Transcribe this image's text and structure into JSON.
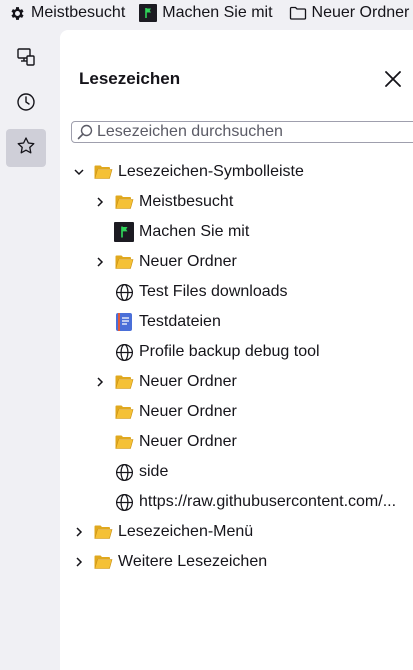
{
  "toolbar": {
    "items": [
      {
        "label": "Meistbesucht",
        "icon": "gear-icon"
      },
      {
        "label": "Machen Sie mit",
        "icon": "green-flag-icon"
      },
      {
        "label": "Neuer Ordner",
        "icon": "folder-icon"
      }
    ]
  },
  "rail": {
    "items": [
      {
        "name": "synced-tabs",
        "icon": "synced-tabs-icon",
        "active": false
      },
      {
        "name": "history",
        "icon": "clock-icon",
        "active": false
      },
      {
        "name": "bookmarks",
        "icon": "star-icon",
        "active": true
      }
    ]
  },
  "panel": {
    "title": "Lesezeichen",
    "search_placeholder": "Lesezeichen durchsuchen",
    "search_value": ""
  },
  "tree": {
    "root": {
      "label": "Lesezeichen-Symbolleiste",
      "expanded": true,
      "icon": "folder-icon"
    },
    "children": [
      {
        "label": "Meistbesucht",
        "type": "folder",
        "expanded": false,
        "icon": "folder-icon"
      },
      {
        "label": "Machen Sie mit",
        "type": "bookmark",
        "icon": "green-flag-icon"
      },
      {
        "label": "Neuer Ordner",
        "type": "folder",
        "expanded": false,
        "icon": "folder-icon"
      },
      {
        "label": "Test Files downloads",
        "type": "bookmark",
        "icon": "globe-icon"
      },
      {
        "label": "Testdateien",
        "type": "bookmark",
        "icon": "docs-icon"
      },
      {
        "label": "Profile backup debug tool",
        "type": "bookmark",
        "icon": "globe-icon"
      },
      {
        "label": "Neuer Ordner",
        "type": "folder",
        "expanded": false,
        "icon": "folder-icon"
      },
      {
        "label": "Neuer Ordner",
        "type": "folder-empty",
        "icon": "folder-icon"
      },
      {
        "label": "Neuer Ordner",
        "type": "folder-empty",
        "icon": "folder-icon"
      },
      {
        "label": "side",
        "type": "bookmark",
        "icon": "globe-icon"
      },
      {
        "label": "https://raw.githubusercontent.com/...",
        "type": "bookmark",
        "icon": "globe-icon"
      }
    ],
    "other_roots": [
      {
        "label": "Lesezeichen-Menü",
        "expanded": false,
        "icon": "folder-icon"
      },
      {
        "label": "Weitere Lesezeichen",
        "expanded": false,
        "icon": "folder-icon"
      }
    ]
  },
  "colors": {
    "background": "#f0f0f4",
    "panel": "#ffffff",
    "folder": "#f5c136",
    "text": "#15141a",
    "active_rail": "#cfcfd8"
  }
}
